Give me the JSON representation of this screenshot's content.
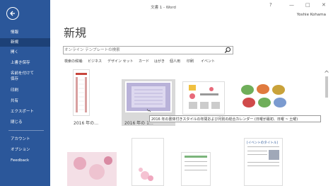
{
  "window": {
    "title": "文書 1 - Word",
    "help": "?",
    "minimize": "—",
    "restore": "□",
    "close": "✕",
    "user": "Yoshie Kohama"
  },
  "sidebar": {
    "back_icon": "back-arrow-icon",
    "items": [
      {
        "label": "情報"
      },
      {
        "label": "新規"
      },
      {
        "label": "開く"
      },
      {
        "label": "上書き保存"
      },
      {
        "label": "名前を付けて"
      },
      {
        "label": "保存"
      },
      {
        "label": "印刷"
      },
      {
        "label": "共有"
      },
      {
        "label": "エクスポート"
      },
      {
        "label": "閉じる"
      },
      {
        "label": "アカウント"
      },
      {
        "label": "オプション"
      },
      {
        "label": "Feedback"
      }
    ]
  },
  "main": {
    "title": "新規",
    "search": {
      "placeholder": "オンライン テンプレートの検索",
      "icon": "search-icon"
    },
    "suggested_label": "検索の候補:",
    "suggestions": [
      "ビジネス",
      "デザイン セット",
      "カード",
      "はがき",
      "個人用",
      "印刷",
      "イベント"
    ],
    "templates": [
      {
        "label": "2016 年の…"
      },
      {
        "label": "2016 年の 1…"
      },
      {
        "label": ""
      },
      {
        "label": ""
      }
    ],
    "tooltip": "2016 年の書体付きスタイルの年間および月別の総合カレンダー (日曜が最初、日曜 ~ 土曜)",
    "template_header_text": "[イベントのタイトル]"
  },
  "colors": {
    "sidebar": "#2b579a",
    "sidebar_active": "#1d4177",
    "accent": "#2b579a"
  }
}
